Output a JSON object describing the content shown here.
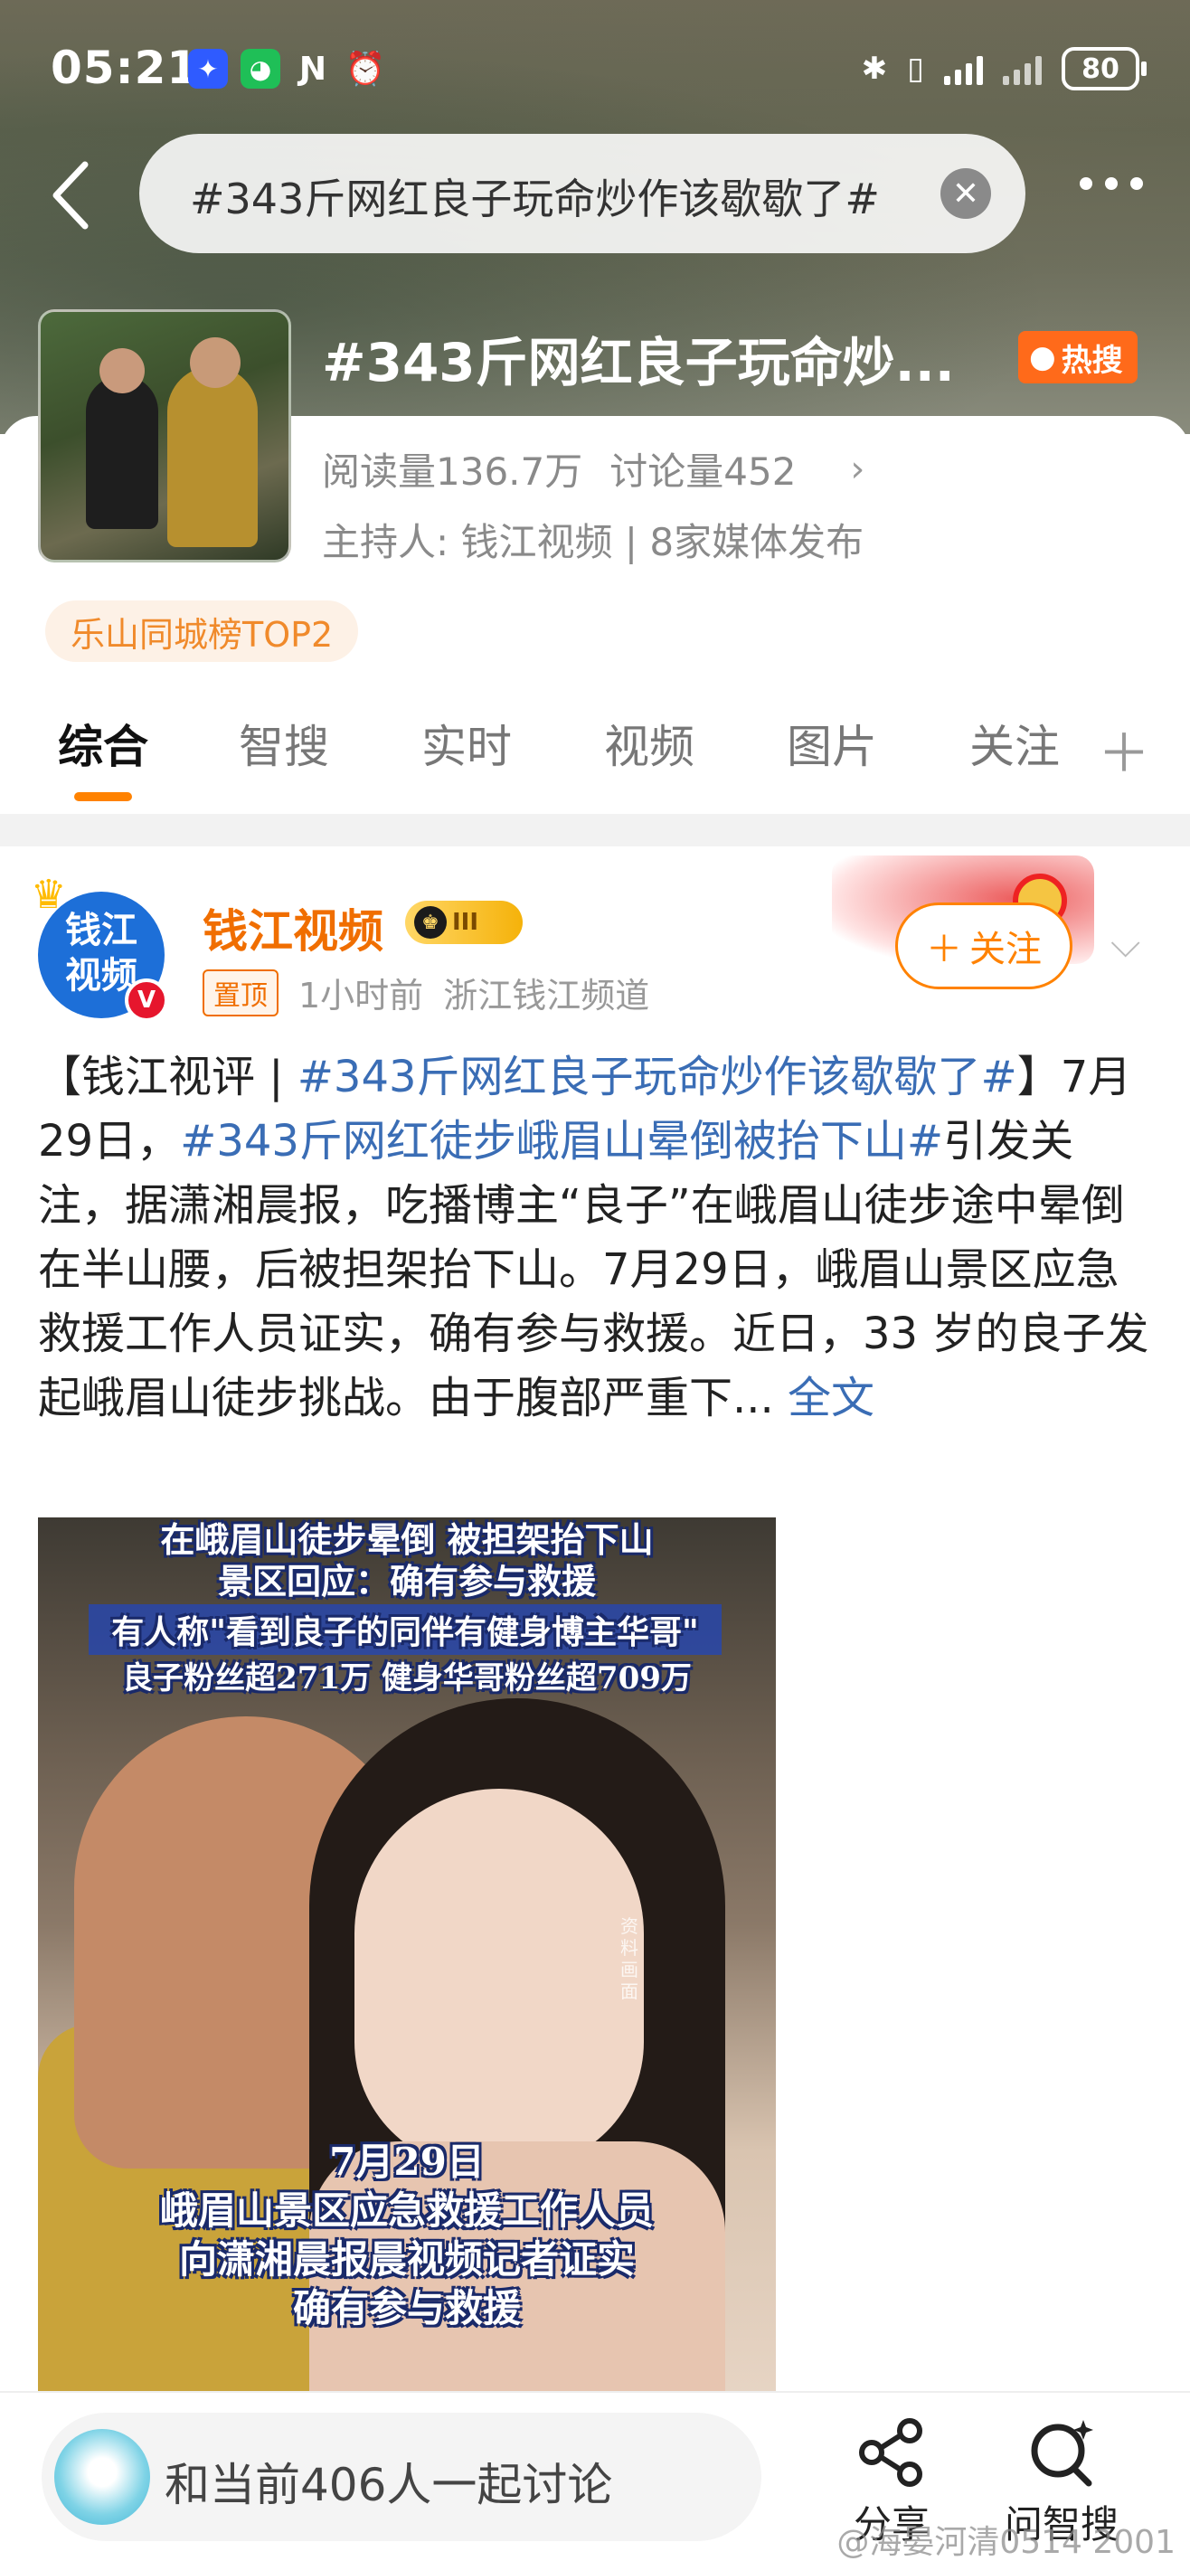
{
  "status_bar": {
    "time": "05:21",
    "battery": "80"
  },
  "search": {
    "query": "#343斤网红良子玩命炒作该歇歇了#",
    "clear_icon": "close-icon"
  },
  "topic": {
    "title": "#343斤网红良子玩命炒...",
    "hot_label": "热搜",
    "reads": "阅读量136.7万",
    "discussions": "讨论量452",
    "host": "主持人:  钱江视频 | 8家媒体发布",
    "rank_tag": "乐山同城榜TOP2"
  },
  "tabs": [
    {
      "label": "综合"
    },
    {
      "label": "智搜"
    },
    {
      "label": "实时"
    },
    {
      "label": "视频"
    },
    {
      "label": "图片"
    },
    {
      "label": "关注"
    }
  ],
  "post": {
    "avatar_text": "钱江视频",
    "author": "钱江视频",
    "level": "III",
    "pin_label": "置顶",
    "time": "1小时前",
    "source": "浙江钱江频道",
    "follow_label": "关注",
    "text_parts": {
      "p1": "【钱江视评 | ",
      "tag1": "#343斤网红良子玩命炒作该歇歇了#",
      "p2": "】7月29日，",
      "tag2": "#343斤网红徒步峨眉山晕倒被抬下山#",
      "p3": "引发关注，据潇湘晨报，吃播博主“良子”在峨眉山徒步途中晕倒在半山腰，后被担架抬下山。7月29日，峨眉山景区应急救援工作人员证实，确有参与救援。近日，33 岁的良子发起峨眉山徒步挑战。由于腹部严重下...",
      "more": " 全文"
    },
    "video_captions": {
      "line1": "在峨眉山徒步晕倒 被担架抬下山",
      "line2": "景区回应：确有参与救援",
      "line3": "有人称\"看到良子的同伴有健身博主华哥\"",
      "line4": "良子粉丝超271万 健身华哥粉丝超709万",
      "side_note": "资料画面",
      "bottom1": "7月29日",
      "bottom2": "峨眉山景区应急救援工作人员",
      "bottom3": "向潇湘晨报晨视频记者证实",
      "bottom4": "确有参与救援"
    }
  },
  "bottom_bar": {
    "discuss_text": "和当前406人一起讨论",
    "share_label": "分享",
    "ask_label": "问智搜"
  },
  "watermark": "@海晏河清0514 2001"
}
